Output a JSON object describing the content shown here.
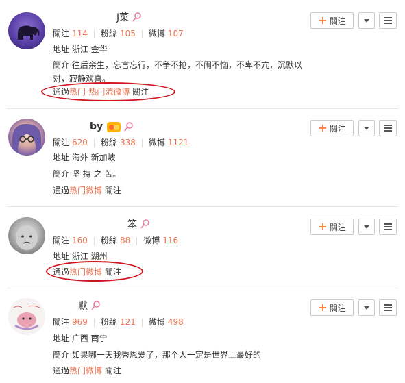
{
  "labels": {
    "following": "關注",
    "fans": "粉絲",
    "weibo": "微博",
    "address": "地址",
    "intro": "簡介",
    "via": "通過",
    "follow_suffix": "關注",
    "follow_button": "關注"
  },
  "users": [
    {
      "name": "J菜",
      "following": "114",
      "fans": "105",
      "weibo": "107",
      "address": "浙江 金华",
      "intro": "往后余生，忘言忘行，不争不抢，不闹不恼，不卑不亢，沉默以对，寂静欢喜。",
      "via": "热门-热门流微博"
    },
    {
      "name": "by",
      "following": "620",
      "fans": "338",
      "weibo": "1121",
      "address": "海外 新加坡",
      "intro": "坚 持 之 苦。",
      "via": "热门微博"
    },
    {
      "name": "笨",
      "following": "160",
      "fans": "88",
      "weibo": "116",
      "address": "浙江 湖州",
      "via": "热门微博"
    },
    {
      "name": "默",
      "following": "969",
      "fans": "121",
      "weibo": "498",
      "address": "广西 南宁",
      "intro": "如果哪一天我秀恩爱了，那个人一定是世界上最好的",
      "via": "热门微博"
    }
  ],
  "colors": {
    "accent": "#eb7350",
    "female_icon": "#e87ca0",
    "annotation": "#d2141e",
    "plus": "#ff8140"
  }
}
